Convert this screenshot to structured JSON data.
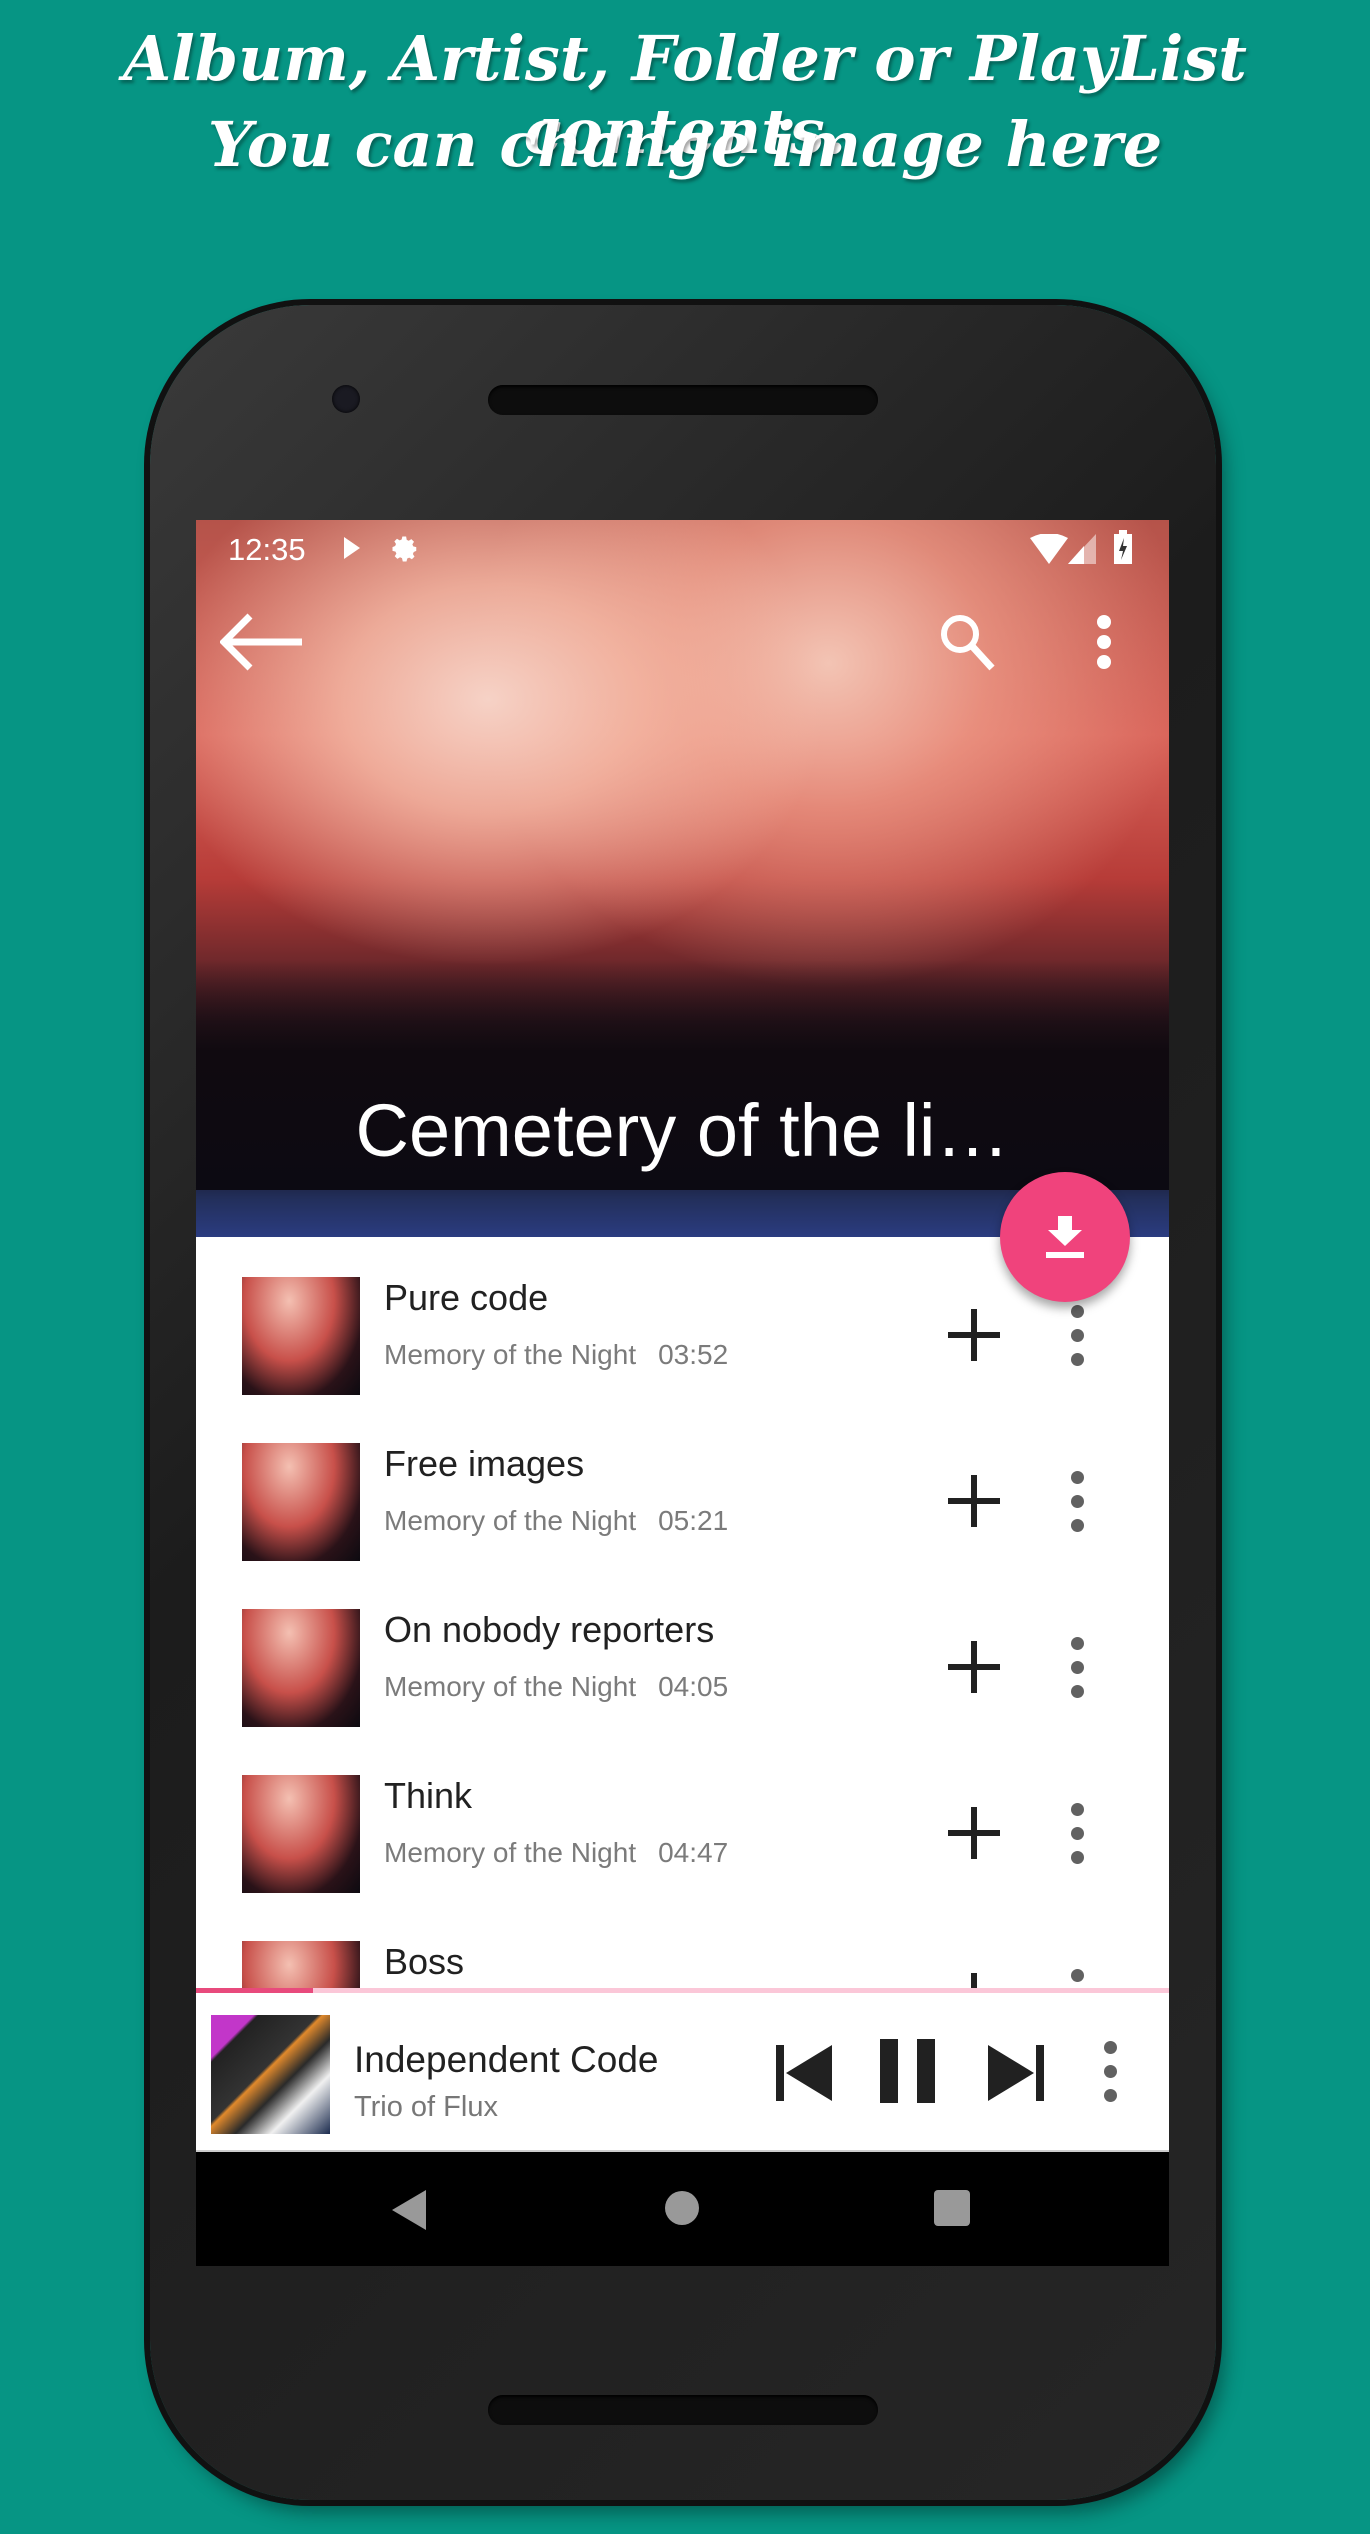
{
  "promo": {
    "line1": "Album, Artist, Folder or PlayList contents.",
    "line2": "You can change image here"
  },
  "status": {
    "time": "12:35",
    "icons": [
      "play-icon",
      "gear-icon",
      "wifi-icon",
      "signal-icon",
      "battery-charging-icon"
    ]
  },
  "appbar": {
    "icons": [
      "back-arrow-icon",
      "search-icon",
      "more-vert-icon"
    ]
  },
  "header": {
    "title": "Cemetery of the li…"
  },
  "fab": {
    "icon": "download-icon",
    "color": "#f0437c"
  },
  "tracks": [
    {
      "title": "Pure code",
      "artist": "Memory of the Night",
      "duration": "03:52"
    },
    {
      "title": "Free images",
      "artist": "Memory of the Night",
      "duration": "05:21"
    },
    {
      "title": "On nobody reporters",
      "artist": "Memory of the Night",
      "duration": "04:05"
    },
    {
      "title": "Think",
      "artist": "Memory of the Night",
      "duration": "04:47"
    },
    {
      "title": "Boss",
      "artist": "",
      "duration": ""
    }
  ],
  "now_playing": {
    "title": "Independent Code",
    "artist": "Trio of Flux",
    "progress_percent": 12,
    "controls": [
      "skip-previous-icon",
      "pause-icon",
      "skip-next-icon",
      "more-vert-icon"
    ]
  },
  "colors": {
    "background": "#069584",
    "accent": "#f0437c"
  }
}
